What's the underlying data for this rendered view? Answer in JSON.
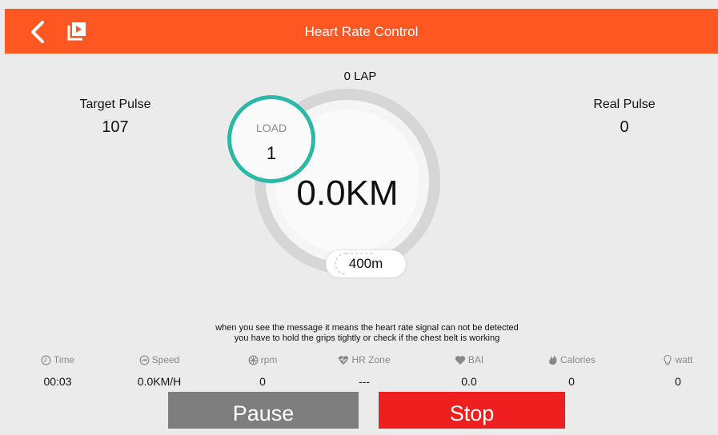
{
  "header": {
    "title": "Heart Rate Control",
    "back_icon": "chevron-left-icon",
    "media_icon": "video-library-icon",
    "background": "#ff5722"
  },
  "lap": {
    "text": "0 LAP"
  },
  "target_pulse": {
    "label": "Target Pulse",
    "value": "107"
  },
  "real_pulse": {
    "label": "Real Pulse",
    "value": "0"
  },
  "load": {
    "label": "LOAD",
    "value": "1",
    "accent": "#2bb8a7"
  },
  "distance": {
    "value": "0.0KM",
    "lap_length": "400m"
  },
  "message": {
    "line1": "when you see the message it means the heart rate signal can not be detected",
    "line2": "you have to hold the grips tightly or check if the chest belt is working"
  },
  "stats": [
    {
      "label": "Time",
      "value": "00:03",
      "icon": "clock-icon"
    },
    {
      "label": "Speed",
      "value": "0.0KM/H",
      "icon": "speed-icon"
    },
    {
      "label": "rpm",
      "value": "0",
      "icon": "wheel-icon"
    },
    {
      "label": "HR Zone",
      "value": "---",
      "icon": "heartbeat-icon"
    },
    {
      "label": "BAI",
      "value": "0.0",
      "icon": "heart-icon"
    },
    {
      "label": "Calories",
      "value": "0",
      "icon": "flame-icon"
    },
    {
      "label": "watt",
      "value": "0",
      "icon": "bulb-icon"
    }
  ],
  "buttons": {
    "pause": "Pause",
    "stop": "Stop"
  },
  "colors": {
    "pause_bg": "#7e7e7e",
    "stop_bg": "#ee1f1f"
  }
}
